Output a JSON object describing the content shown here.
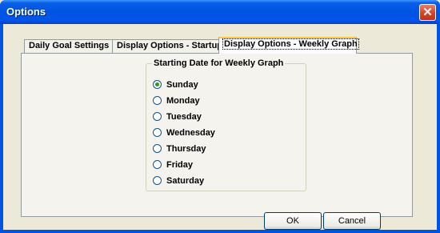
{
  "window": {
    "title": "Options",
    "close_label": "✕"
  },
  "tabs": [
    {
      "label": "Daily Goal Settings"
    },
    {
      "label": "Display Options - Startup"
    },
    {
      "label": "Display Options - Weekly Graph",
      "active": true
    }
  ],
  "group": {
    "legend": "Starting Date for Weekly Graph",
    "options": [
      {
        "label": "Sunday",
        "checked": true
      },
      {
        "label": "Monday"
      },
      {
        "label": "Tuesday"
      },
      {
        "label": "Wednesday"
      },
      {
        "label": "Thursday"
      },
      {
        "label": "Friday"
      },
      {
        "label": "Saturday"
      }
    ]
  },
  "buttons": {
    "ok": "OK",
    "cancel": "Cancel"
  }
}
